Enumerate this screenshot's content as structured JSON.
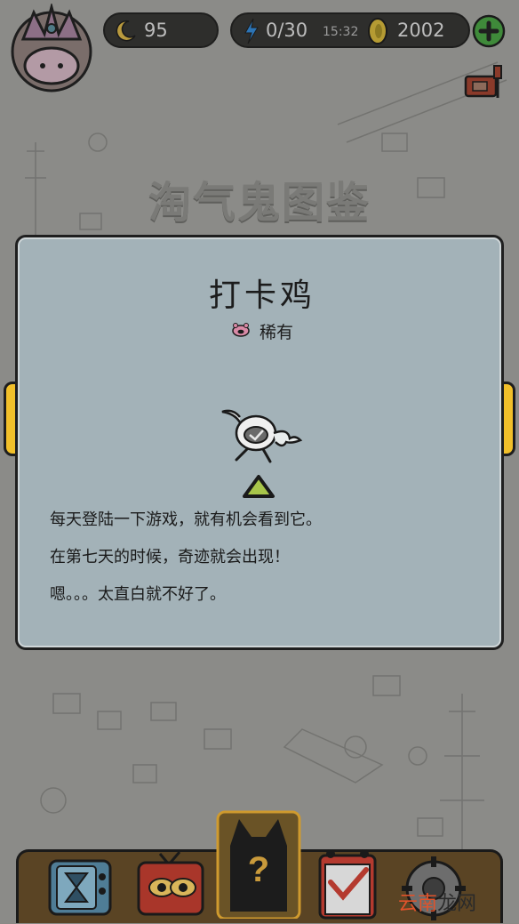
{
  "hud": {
    "moon_count": "95",
    "energy": "0/30",
    "time": "15:32",
    "coins": "2002"
  },
  "page_title": "淘气鬼图鉴",
  "card": {
    "name": "打卡鸡",
    "rarity": "稀有",
    "description": [
      "每天登陆一下游戏，就有机会看到它。",
      "在第七天的时候，奇迹就会出现！",
      "嗯。。。太直白就不好了。"
    ]
  },
  "bottom_nav": {
    "center_mark": "?"
  },
  "watermark": {
    "left": "云南",
    "right": "龙网"
  },
  "colors": {
    "card_bg": "#a3b2b8",
    "arrow_yellow": "#f2c02a",
    "nav_brown": "#5a4424",
    "green_plus": "#4caf50",
    "watermark_red": "#e0532b"
  }
}
